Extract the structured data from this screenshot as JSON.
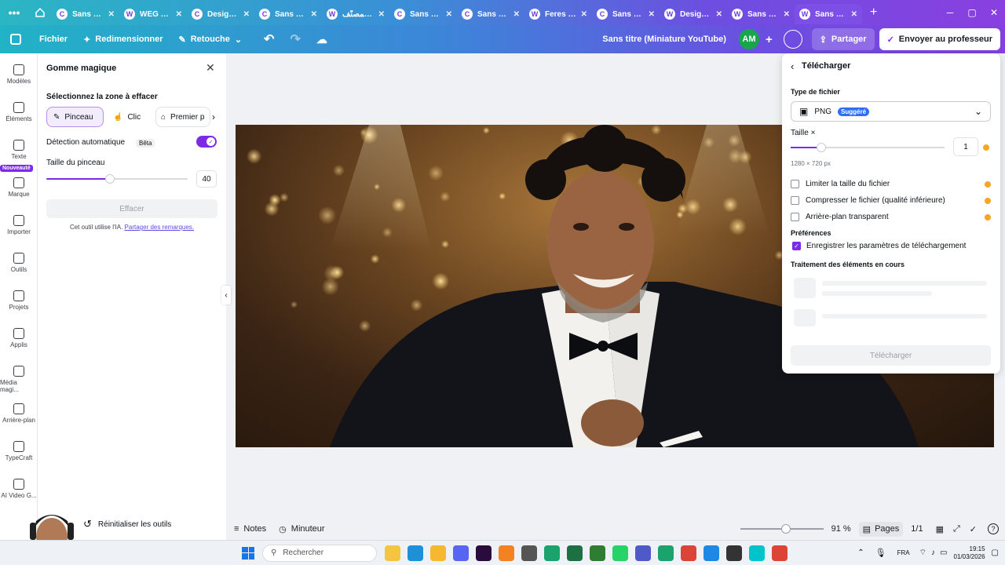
{
  "tabs": [
    {
      "label": "Sans tit...",
      "icon": "C"
    },
    {
      "label": "WEG - ...",
      "icon": "W"
    },
    {
      "label": "Design ...",
      "icon": "C"
    },
    {
      "label": "Sans tit...",
      "icon": "C"
    },
    {
      "label": "المصنّف ...",
      "icon": "W"
    },
    {
      "label": "Sans tit...",
      "icon": "C"
    },
    {
      "label": "Sans tit...",
      "icon": "C"
    },
    {
      "label": "Feres G...",
      "icon": "W"
    },
    {
      "label": "Sans tit...",
      "icon": "C"
    },
    {
      "label": "Design ...",
      "icon": "W"
    },
    {
      "label": "Sans tit...",
      "icon": "W"
    },
    {
      "label": "Sans tit...",
      "icon": "W"
    }
  ],
  "toolbar": {
    "file": "Fichier",
    "resize": "Redimensionner",
    "retouch": "Retouche",
    "doc_title": "Sans titre (Miniature YouTube)",
    "avatar": "AM",
    "share": "Partager",
    "send": "Envoyer au professeur"
  },
  "rail": [
    {
      "label": "Modèles",
      "icon": "templates-icon"
    },
    {
      "label": "Éléments",
      "icon": "elements-icon"
    },
    {
      "label": "Texte",
      "icon": "text-icon"
    },
    {
      "label": "Marque",
      "icon": "brand-icon",
      "badge": "Nouveauté"
    },
    {
      "label": "Importer",
      "icon": "upload-icon"
    },
    {
      "label": "Outils",
      "icon": "tools-icon"
    },
    {
      "label": "Projets",
      "icon": "folder-icon"
    },
    {
      "label": "Applis",
      "icon": "apps-icon"
    },
    {
      "label": "Média magi...",
      "icon": "magic-media-icon"
    },
    {
      "label": "Arrière-plan",
      "icon": "background-icon"
    },
    {
      "label": "TypeCraft",
      "icon": "typecraft-icon"
    },
    {
      "label": "AI Video G...",
      "icon": "ai-video-icon"
    }
  ],
  "panel": {
    "title": "Gomme magique",
    "select_label": "Sélectionnez la zone à effacer",
    "modes": [
      "Pinceau",
      "Clic",
      "Premier p"
    ],
    "auto_detect": "Détection automatique",
    "beta": "Bêta",
    "brush_size_label": "Taille du pinceau",
    "brush_size_value": "40",
    "brush_level": 0.45,
    "erase_button": "Effacer",
    "ai_note": "Cet outil utilise l'IA.",
    "feedback_link": "Partager des remarques.",
    "reset": "Réinitialiser les outils"
  },
  "download": {
    "title": "Télécharger",
    "filetype_label": "Type de fichier",
    "filetype_value": "PNG",
    "suggested": "Suggéré",
    "size_label": "Taille ×",
    "size_value": "1",
    "size_level": 0.2,
    "dimensions": "1280 × 720 px",
    "options": [
      {
        "label": "Limiter la taille du fichier",
        "checked": false,
        "premium": true
      },
      {
        "label": "Compresser le fichier (qualité inférieure)",
        "checked": false,
        "premium": true
      },
      {
        "label": "Arrière-plan transparent",
        "checked": false,
        "premium": true
      }
    ],
    "prefs_label": "Préférences",
    "save_prefs": "Enregistrer les paramètres de téléchargement",
    "processing": "Traitement des éléments en cours",
    "download_button": "Télécharger"
  },
  "bottom": {
    "notes": "Notes",
    "timer": "Minuteur",
    "zoom": "91 %",
    "zoom_level": 0.55,
    "pages": "Pages",
    "page_count": "1/1"
  },
  "taskbar": {
    "search_placeholder": "Rechercher",
    "lang": "FRA",
    "time": "19:15",
    "date": "01/03/2026"
  },
  "colors": {
    "accent": "#7d2ae8",
    "badge_blue": "#2d6ff5"
  }
}
